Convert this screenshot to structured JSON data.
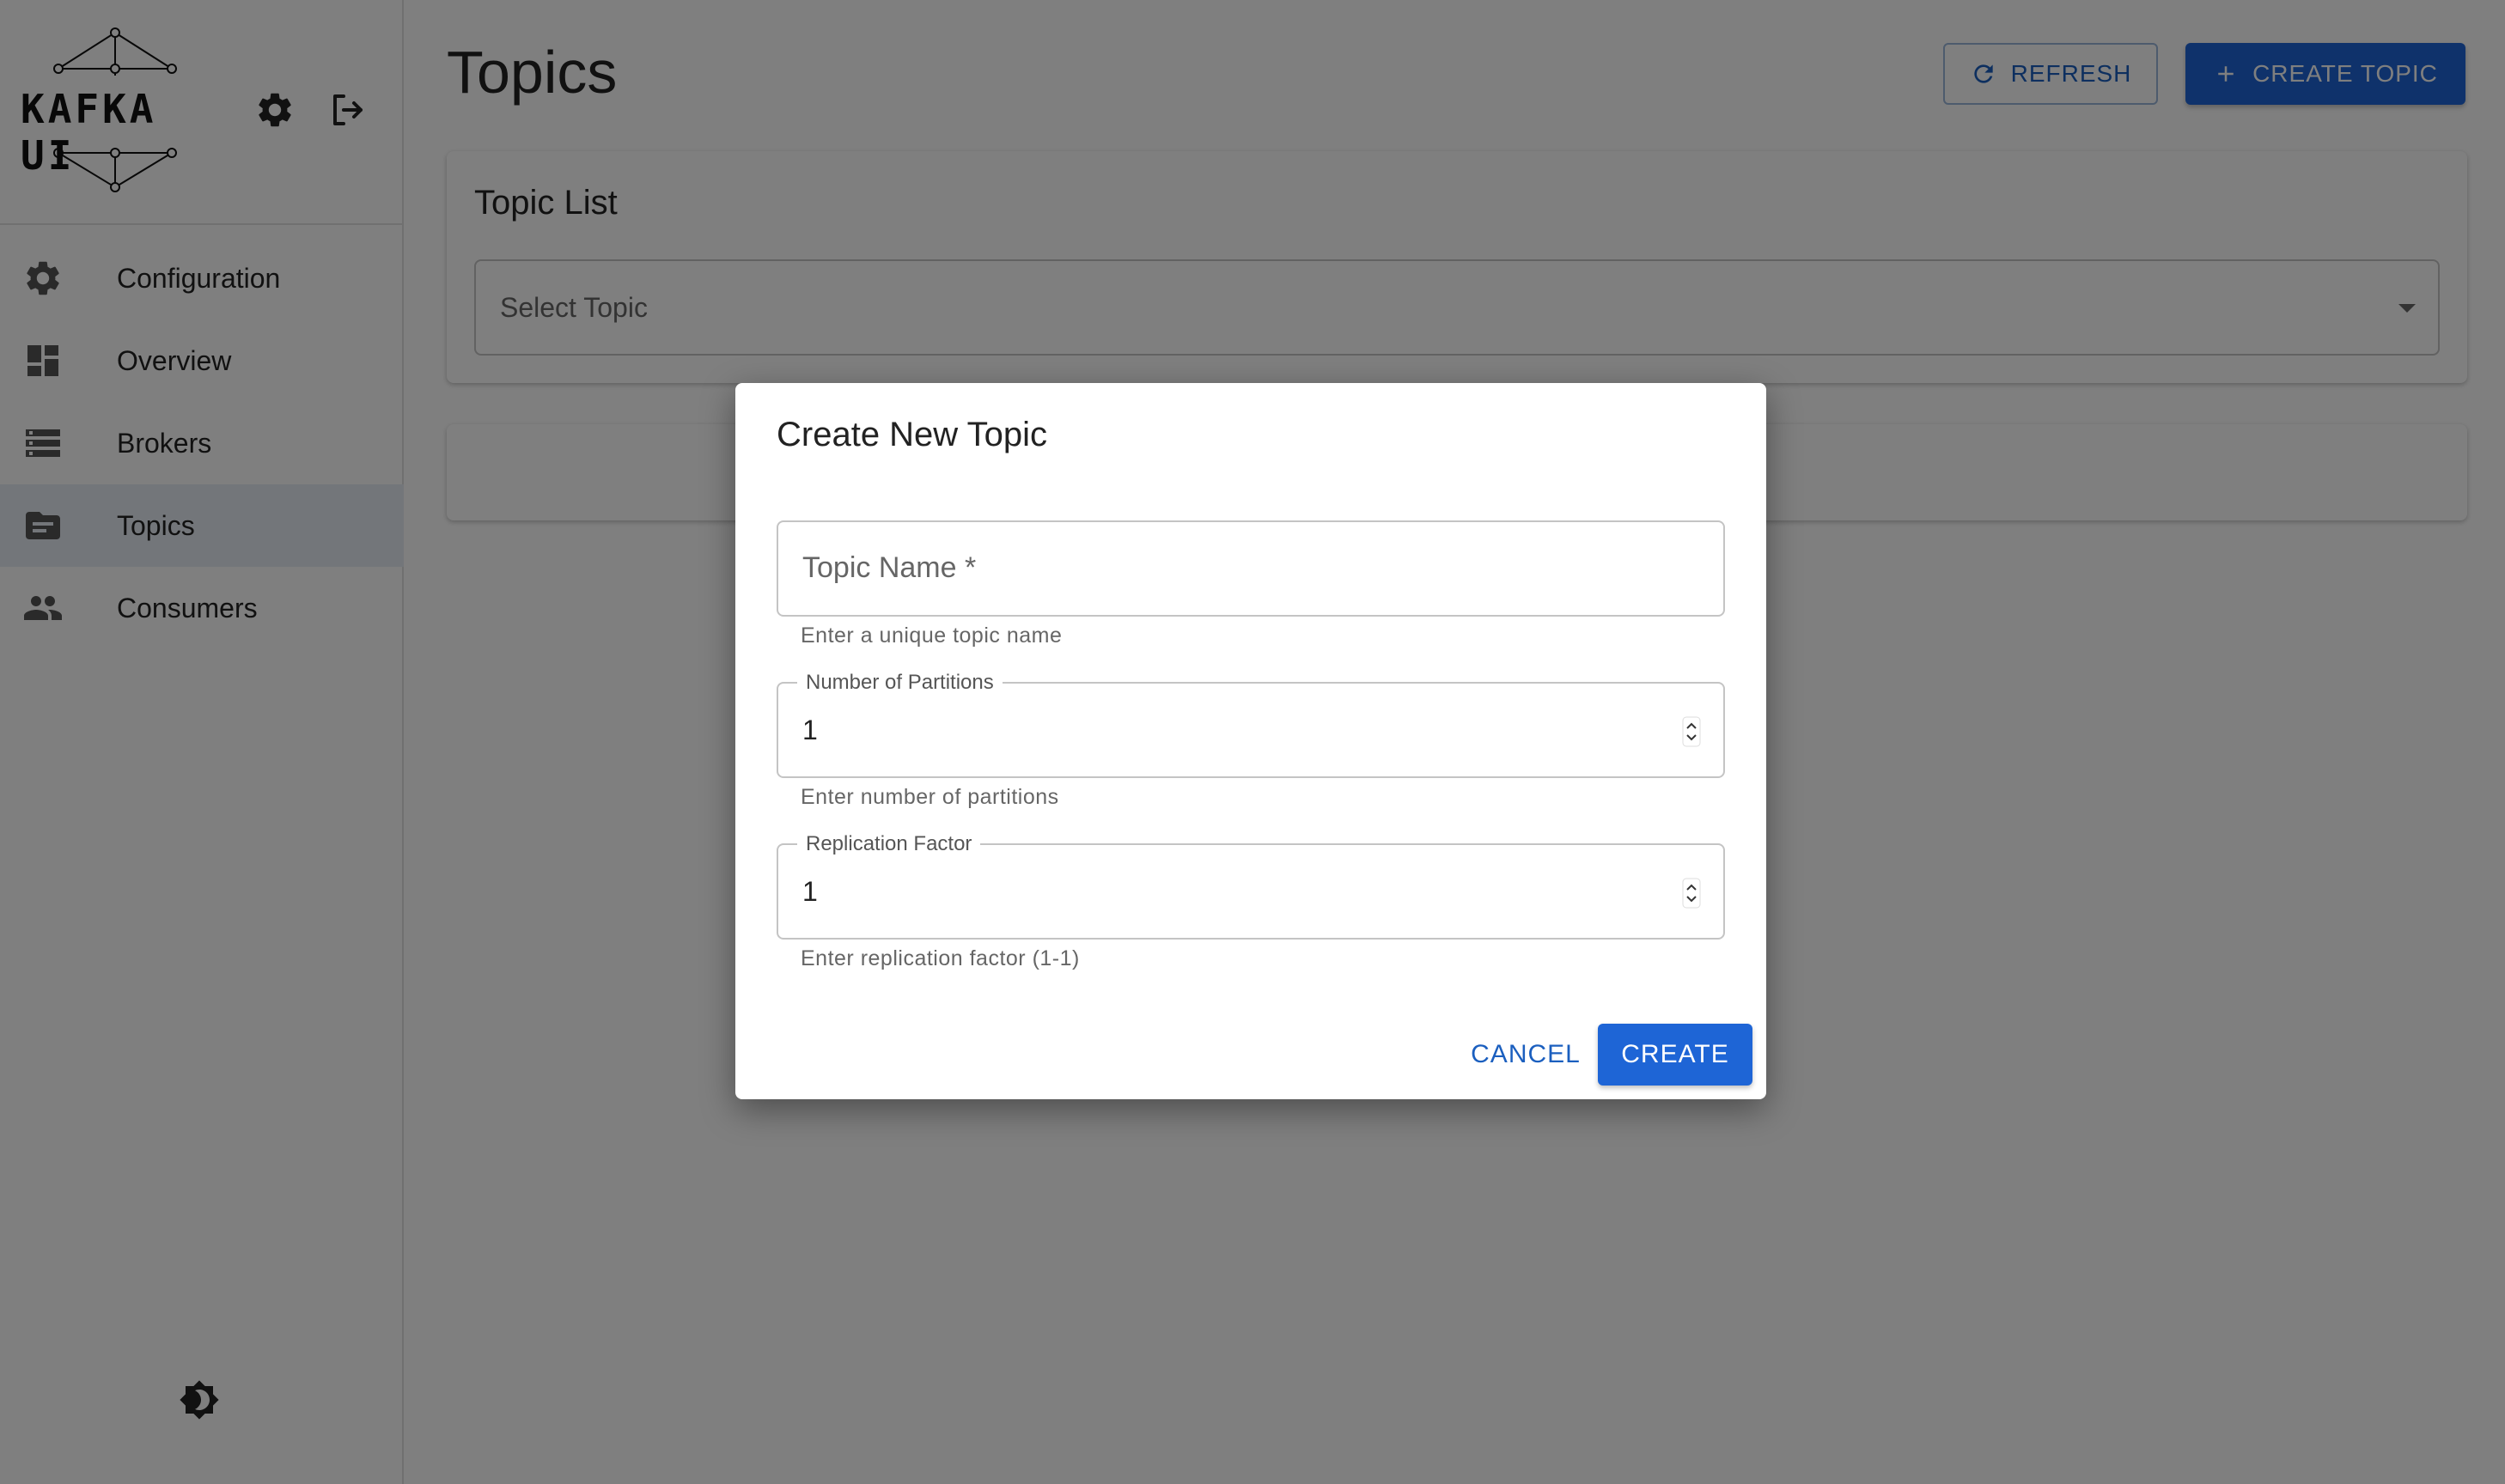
{
  "app": {
    "logo_text": "KAFKA UI"
  },
  "sidebar": {
    "top_icons": [
      "gear-icon",
      "logout-icon"
    ],
    "items": [
      {
        "label": "Configuration",
        "icon": "gear-icon"
      },
      {
        "label": "Overview",
        "icon": "dashboard-icon"
      },
      {
        "label": "Brokers",
        "icon": "storage-icon"
      },
      {
        "label": "Topics",
        "icon": "topic-icon",
        "active": true
      },
      {
        "label": "Consumers",
        "icon": "people-icon"
      }
    ],
    "theme_icon": "brightness-icon"
  },
  "header": {
    "title": "Topics",
    "refresh_label": "REFRESH",
    "create_topic_label": "CREATE TOPIC"
  },
  "topic_list": {
    "title": "Topic List",
    "select_placeholder": "Select Topic"
  },
  "dialog": {
    "title": "Create New Topic",
    "topic_name": {
      "label": "Topic Name *",
      "value": "",
      "helper": "Enter a unique topic name"
    },
    "partitions": {
      "label": "Number of Partitions",
      "value": "1",
      "helper": "Enter number of partitions"
    },
    "replication": {
      "label": "Replication Factor",
      "value": "1",
      "helper": "Enter replication factor (1-1)"
    },
    "cancel_label": "CANCEL",
    "create_label": "CREATE"
  },
  "colors": {
    "primary": "#1e65d6",
    "active_nav_bg": "#e6edf4",
    "overlay": "rgba(0,0,0,0.5)"
  }
}
